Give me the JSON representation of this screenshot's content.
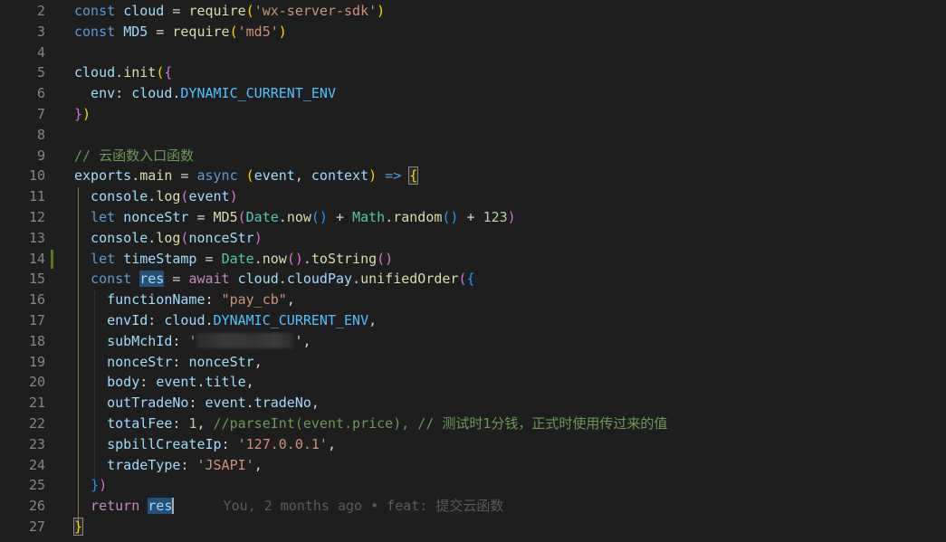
{
  "editor": {
    "git_status": "modified",
    "lines": [
      {
        "num": "2",
        "segments": [
          {
            "t": "const ",
            "c": "kw"
          },
          {
            "t": "cloud",
            "c": "var"
          },
          {
            "t": " = ",
            "c": "pun"
          },
          {
            "t": "require",
            "c": "fn"
          },
          {
            "t": "(",
            "c": "br1"
          },
          {
            "t": "'wx-server-sdk'",
            "c": "str"
          },
          {
            "t": ")",
            "c": "br1"
          }
        ]
      },
      {
        "num": "3",
        "segments": [
          {
            "t": "const ",
            "c": "kw"
          },
          {
            "t": "MD5",
            "c": "var"
          },
          {
            "t": " = ",
            "c": "pun"
          },
          {
            "t": "require",
            "c": "fn"
          },
          {
            "t": "(",
            "c": "br1"
          },
          {
            "t": "'md5'",
            "c": "str"
          },
          {
            "t": ")",
            "c": "br1"
          }
        ]
      },
      {
        "num": "4",
        "segments": []
      },
      {
        "num": "5",
        "segments": [
          {
            "t": "cloud",
            "c": "var"
          },
          {
            "t": ".",
            "c": "pun"
          },
          {
            "t": "init",
            "c": "fn"
          },
          {
            "t": "(",
            "c": "br1"
          },
          {
            "t": "{",
            "c": "br2"
          }
        ]
      },
      {
        "num": "6",
        "segments": [
          {
            "t": "  env",
            "c": "var"
          },
          {
            "t": ": ",
            "c": "pun"
          },
          {
            "t": "cloud",
            "c": "var"
          },
          {
            "t": ".",
            "c": "pun"
          },
          {
            "t": "DYNAMIC_CURRENT_ENV",
            "c": "const"
          }
        ]
      },
      {
        "num": "7",
        "segments": [
          {
            "t": "}",
            "c": "br2"
          },
          {
            "t": ")",
            "c": "br1"
          }
        ]
      },
      {
        "num": "8",
        "segments": []
      },
      {
        "num": "9",
        "segments": [
          {
            "t": "// 云函数入口函数",
            "c": "cmt"
          }
        ]
      },
      {
        "num": "10",
        "segments": [
          {
            "t": "exports",
            "c": "var"
          },
          {
            "t": ".",
            "c": "pun"
          },
          {
            "t": "main",
            "c": "fn"
          },
          {
            "t": " = ",
            "c": "pun"
          },
          {
            "t": "async",
            "c": "kw"
          },
          {
            "t": " ",
            "c": "pun"
          },
          {
            "t": "(",
            "c": "br1"
          },
          {
            "t": "event",
            "c": "var"
          },
          {
            "t": ", ",
            "c": "pun"
          },
          {
            "t": "context",
            "c": "var"
          },
          {
            "t": ")",
            "c": "br1"
          },
          {
            "t": " => ",
            "c": "kw"
          },
          {
            "t": "{",
            "c": "br1 hl-box"
          }
        ]
      },
      {
        "num": "11",
        "segments": [
          {
            "t": "  console",
            "c": "var"
          },
          {
            "t": ".",
            "c": "pun"
          },
          {
            "t": "log",
            "c": "fn"
          },
          {
            "t": "(",
            "c": "br2"
          },
          {
            "t": "event",
            "c": "var"
          },
          {
            "t": ")",
            "c": "br2"
          }
        ]
      },
      {
        "num": "12",
        "segments": [
          {
            "t": "  let ",
            "c": "kw"
          },
          {
            "t": "nonceStr",
            "c": "var"
          },
          {
            "t": " = ",
            "c": "pun"
          },
          {
            "t": "MD5",
            "c": "fn"
          },
          {
            "t": "(",
            "c": "br2"
          },
          {
            "t": "Date",
            "c": "cls"
          },
          {
            "t": ".",
            "c": "pun"
          },
          {
            "t": "now",
            "c": "fn"
          },
          {
            "t": "()",
            "c": "br3"
          },
          {
            "t": " + ",
            "c": "pun"
          },
          {
            "t": "Math",
            "c": "cls"
          },
          {
            "t": ".",
            "c": "pun"
          },
          {
            "t": "random",
            "c": "fn"
          },
          {
            "t": "()",
            "c": "br3"
          },
          {
            "t": " + ",
            "c": "pun"
          },
          {
            "t": "123",
            "c": "num"
          },
          {
            "t": ")",
            "c": "br2"
          }
        ]
      },
      {
        "num": "13",
        "segments": [
          {
            "t": "  console",
            "c": "var"
          },
          {
            "t": ".",
            "c": "pun"
          },
          {
            "t": "log",
            "c": "fn"
          },
          {
            "t": "(",
            "c": "br2"
          },
          {
            "t": "nonceStr",
            "c": "var"
          },
          {
            "t": ")",
            "c": "br2"
          }
        ]
      },
      {
        "num": "14",
        "segments": [
          {
            "t": "  let ",
            "c": "kw"
          },
          {
            "t": "timeStamp",
            "c": "var"
          },
          {
            "t": " = ",
            "c": "pun"
          },
          {
            "t": "Date",
            "c": "cls"
          },
          {
            "t": ".",
            "c": "pun"
          },
          {
            "t": "now",
            "c": "fn"
          },
          {
            "t": "()",
            "c": "br2"
          },
          {
            "t": ".",
            "c": "pun"
          },
          {
            "t": "toString",
            "c": "fn"
          },
          {
            "t": "()",
            "c": "br2"
          }
        ]
      },
      {
        "num": "15",
        "segments": [
          {
            "t": "  const ",
            "c": "kw"
          },
          {
            "t": "res",
            "c": "var res-hl"
          },
          {
            "t": " = ",
            "c": "pun"
          },
          {
            "t": "await",
            "c": "ctrl"
          },
          {
            "t": " ",
            "c": "pun"
          },
          {
            "t": "cloud",
            "c": "var"
          },
          {
            "t": ".",
            "c": "pun"
          },
          {
            "t": "cloudPay",
            "c": "var"
          },
          {
            "t": ".",
            "c": "pun"
          },
          {
            "t": "unifiedOrder",
            "c": "fn"
          },
          {
            "t": "(",
            "c": "br2"
          },
          {
            "t": "{",
            "c": "br3"
          }
        ]
      },
      {
        "num": "16",
        "segments": [
          {
            "t": "    functionName",
            "c": "var"
          },
          {
            "t": ": ",
            "c": "pun"
          },
          {
            "t": "\"pay_cb\"",
            "c": "str"
          },
          {
            "t": ",",
            "c": "pun"
          }
        ]
      },
      {
        "num": "17",
        "segments": [
          {
            "t": "    envId",
            "c": "var"
          },
          {
            "t": ": ",
            "c": "pun"
          },
          {
            "t": "cloud",
            "c": "var"
          },
          {
            "t": ".",
            "c": "pun"
          },
          {
            "t": "DYNAMIC_CURRENT_ENV",
            "c": "const"
          },
          {
            "t": ",",
            "c": "pun"
          }
        ]
      },
      {
        "num": "18",
        "segments": [
          {
            "t": "    subMchId",
            "c": "var"
          },
          {
            "t": ": ",
            "c": "pun"
          },
          {
            "t": "'",
            "c": "str"
          },
          {
            "t": "",
            "c": "redact"
          },
          {
            "t": "',",
            "c": "pun"
          }
        ]
      },
      {
        "num": "19",
        "segments": [
          {
            "t": "    nonceStr",
            "c": "var"
          },
          {
            "t": ": ",
            "c": "pun"
          },
          {
            "t": "nonceStr",
            "c": "var"
          },
          {
            "t": ",",
            "c": "pun"
          }
        ]
      },
      {
        "num": "20",
        "segments": [
          {
            "t": "    body",
            "c": "var"
          },
          {
            "t": ": ",
            "c": "pun"
          },
          {
            "t": "event",
            "c": "var"
          },
          {
            "t": ".",
            "c": "pun"
          },
          {
            "t": "title",
            "c": "var"
          },
          {
            "t": ",",
            "c": "pun"
          }
        ]
      },
      {
        "num": "21",
        "segments": [
          {
            "t": "    outTradeNo",
            "c": "var"
          },
          {
            "t": ": ",
            "c": "pun"
          },
          {
            "t": "event",
            "c": "var"
          },
          {
            "t": ".",
            "c": "pun"
          },
          {
            "t": "tradeNo",
            "c": "var"
          },
          {
            "t": ",",
            "c": "pun"
          }
        ]
      },
      {
        "num": "22",
        "segments": [
          {
            "t": "    totalFee",
            "c": "var"
          },
          {
            "t": ": ",
            "c": "pun"
          },
          {
            "t": "1",
            "c": "num"
          },
          {
            "t": ", ",
            "c": "pun"
          },
          {
            "t": "//parseInt(event.price), // 测试时1分钱，正式时使用传过来的值",
            "c": "cmt"
          }
        ]
      },
      {
        "num": "23",
        "segments": [
          {
            "t": "    spbillCreateIp",
            "c": "var"
          },
          {
            "t": ": ",
            "c": "pun"
          },
          {
            "t": "'127.0.0.1'",
            "c": "str"
          },
          {
            "t": ",",
            "c": "pun"
          }
        ]
      },
      {
        "num": "24",
        "segments": [
          {
            "t": "    tradeType",
            "c": "var"
          },
          {
            "t": ": ",
            "c": "pun"
          },
          {
            "t": "'JSAPI'",
            "c": "str"
          },
          {
            "t": ",",
            "c": "pun"
          }
        ]
      },
      {
        "num": "25",
        "segments": [
          {
            "t": "  ",
            "c": "pun"
          },
          {
            "t": "}",
            "c": "br3"
          },
          {
            "t": ")",
            "c": "br2"
          }
        ]
      },
      {
        "num": "26",
        "segments": [
          {
            "t": "  return ",
            "c": "ctrl"
          },
          {
            "t": "res",
            "c": "var res-hl"
          },
          {
            "t": "|",
            "c": "cursor"
          },
          {
            "t": "      You, 2 months ago • feat: 提交云函数",
            "c": "blame"
          }
        ]
      },
      {
        "num": "27",
        "segments": [
          {
            "t": "}",
            "c": "br1 hl-box"
          }
        ]
      }
    ]
  }
}
